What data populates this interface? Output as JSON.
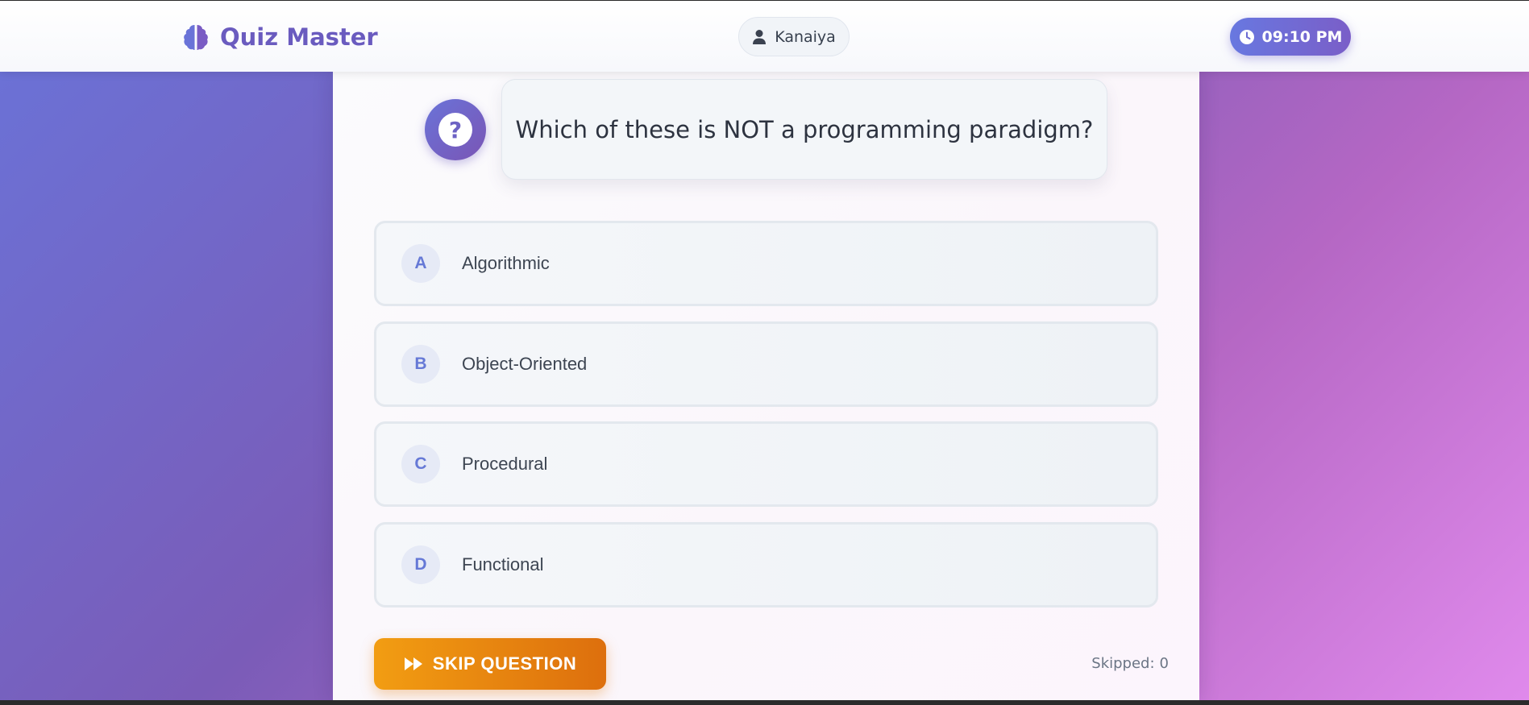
{
  "header": {
    "app_title": "Quiz Master",
    "brand_icon": "brain-icon",
    "user_name": "Kanaiya",
    "user_icon": "user-icon",
    "time": "09:10 PM",
    "time_icon": "clock-icon"
  },
  "question": {
    "badge_symbol": "?",
    "text": "Which of these is NOT a programming paradigm?"
  },
  "options": [
    {
      "letter": "A",
      "label": "Algorithmic"
    },
    {
      "letter": "B",
      "label": "Object-Oriented"
    },
    {
      "letter": "C",
      "label": "Procedural"
    },
    {
      "letter": "D",
      "label": "Functional"
    }
  ],
  "footer": {
    "skip_label": "SKIP QUESTION",
    "skip_icon": "fast-forward-icon",
    "skipped_label": "Skipped:",
    "skipped_count": "0"
  },
  "colors": {
    "accent": "#6a5bbf",
    "skip_button": "#f29d12",
    "option_letter": "#6679d6"
  }
}
